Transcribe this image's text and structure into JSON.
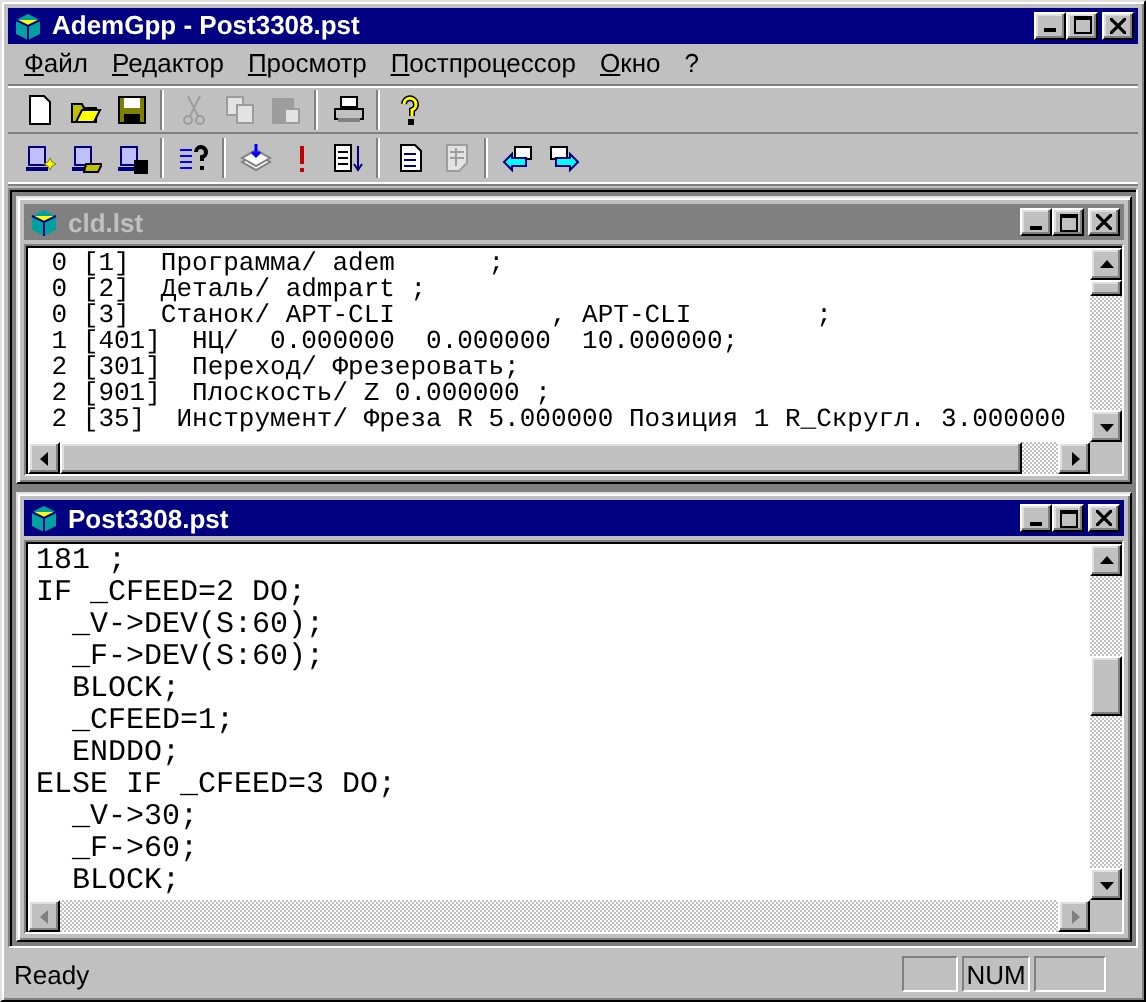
{
  "window": {
    "title": "AdemGpp - Post3308.pst"
  },
  "menu": [
    "Файл",
    "Редактор",
    "Просмотр",
    "Постпроцессор",
    "Окно",
    "?"
  ],
  "toolbars": [
    [
      {
        "kind": "new",
        "disabled": false
      },
      {
        "kind": "open",
        "disabled": false
      },
      {
        "kind": "save",
        "disabled": false
      },
      {
        "kind": "sep"
      },
      {
        "kind": "cut",
        "disabled": true
      },
      {
        "kind": "copy",
        "disabled": true
      },
      {
        "kind": "paste",
        "disabled": true
      },
      {
        "kind": "sep"
      },
      {
        "kind": "print",
        "disabled": false
      },
      {
        "kind": "sep"
      },
      {
        "kind": "help",
        "disabled": false
      }
    ],
    [
      {
        "kind": "machine-new",
        "disabled": false
      },
      {
        "kind": "machine-open",
        "disabled": false
      },
      {
        "kind": "machine-save",
        "disabled": false
      },
      {
        "kind": "sep"
      },
      {
        "kind": "list-help",
        "disabled": false
      },
      {
        "kind": "sep"
      },
      {
        "kind": "stack",
        "disabled": false
      },
      {
        "kind": "alert",
        "disabled": false
      },
      {
        "kind": "sort",
        "disabled": false
      },
      {
        "kind": "sep"
      },
      {
        "kind": "page",
        "disabled": false
      },
      {
        "kind": "page-grid",
        "disabled": true
      },
      {
        "kind": "sep"
      },
      {
        "kind": "back",
        "disabled": false
      },
      {
        "kind": "forward",
        "disabled": false
      }
    ]
  ],
  "documents": [
    {
      "title": "cld.lst",
      "active": false,
      "kind": "list",
      "lines": [
        " 0 [1]  Программа/ adem      ;",
        " 0 [2]  Деталь/ admpart ;",
        " 0 [3]  Станок/ APT-CLI          , APT-CLI        ;",
        " 1 [401]  НЦ/  0.000000  0.000000  10.000000;",
        " 2 [301]  Переход/ Фрезеровать;",
        " 2 [901]  Плоскость/ Z 0.000000 ;",
        " 2 [35]  Инструмент/ Фреза R 5.000000 Позиция 1 R_Скругл. 3.000000"
      ]
    },
    {
      "title": "Post3308.pst",
      "active": true,
      "kind": "source",
      "lines": [
        "181 ;",
        "IF _CFEED=2 DO;",
        "  _V->DEV(S:60);",
        "  _F->DEV(S:60);",
        "  BLOCK;",
        "  _CFEED=1;",
        "  ENDDO;",
        "ELSE IF _CFEED=3 DO;",
        "  _V->30;",
        "  _F->60;",
        "  BLOCK;"
      ]
    }
  ],
  "status_bar": {
    "message": "Ready",
    "panels": [
      {
        "kind": "blank"
      },
      {
        "kind": "text",
        "text": "NUM"
      },
      {
        "kind": "blank"
      }
    ]
  }
}
